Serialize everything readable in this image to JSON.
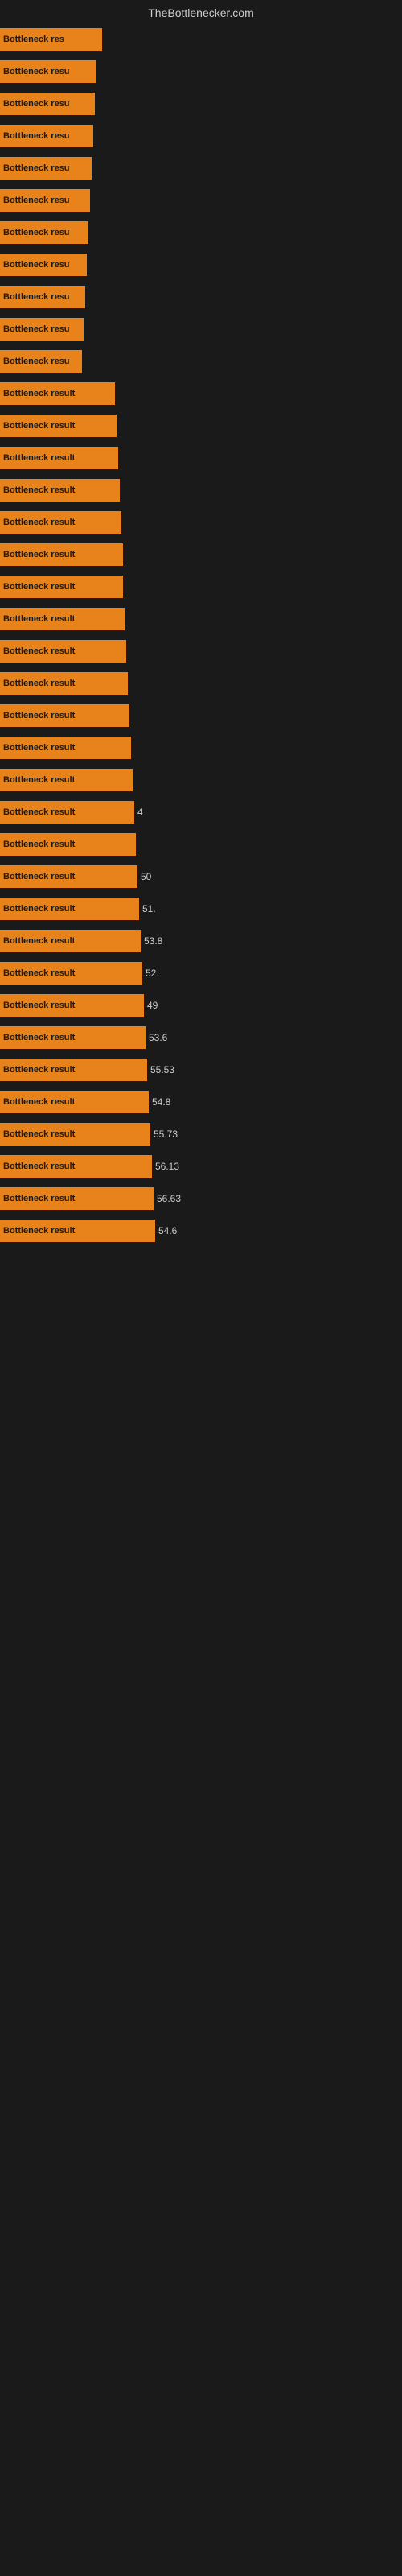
{
  "header": {
    "title": "TheBottlenecker.com"
  },
  "rows": [
    {
      "label": "Bottleneck res",
      "width": 127,
      "value": ""
    },
    {
      "label": "Bottleneck resu",
      "width": 120,
      "value": ""
    },
    {
      "label": "Bottleneck resu",
      "width": 118,
      "value": ""
    },
    {
      "label": "Bottleneck resu",
      "width": 116,
      "value": ""
    },
    {
      "label": "Bottleneck resu",
      "width": 114,
      "value": ""
    },
    {
      "label": "Bottleneck resu",
      "width": 112,
      "value": ""
    },
    {
      "label": "Bottleneck resu",
      "width": 110,
      "value": ""
    },
    {
      "label": "Bottleneck resu",
      "width": 108,
      "value": ""
    },
    {
      "label": "Bottleneck resu",
      "width": 106,
      "value": ""
    },
    {
      "label": "Bottleneck resu",
      "width": 104,
      "value": ""
    },
    {
      "label": "Bottleneck resu",
      "width": 102,
      "value": ""
    },
    {
      "label": "Bottleneck result",
      "width": 143,
      "value": ""
    },
    {
      "label": "Bottleneck result",
      "width": 145,
      "value": ""
    },
    {
      "label": "Bottleneck result",
      "width": 147,
      "value": ""
    },
    {
      "label": "Bottleneck result",
      "width": 149,
      "value": ""
    },
    {
      "label": "Bottleneck result",
      "width": 151,
      "value": ""
    },
    {
      "label": "Bottleneck result",
      "width": 153,
      "value": ""
    },
    {
      "label": "Bottleneck result",
      "width": 153,
      "value": ""
    },
    {
      "label": "Bottleneck result",
      "width": 155,
      "value": ""
    },
    {
      "label": "Bottleneck result",
      "width": 157,
      "value": ""
    },
    {
      "label": "Bottleneck result",
      "width": 159,
      "value": ""
    },
    {
      "label": "Bottleneck result",
      "width": 161,
      "value": ""
    },
    {
      "label": "Bottleneck result",
      "width": 163,
      "value": ""
    },
    {
      "label": "Bottleneck result",
      "width": 165,
      "value": ""
    },
    {
      "label": "Bottleneck result",
      "width": 167,
      "value": "4"
    },
    {
      "label": "Bottleneck result",
      "width": 169,
      "value": ""
    },
    {
      "label": "Bottleneck result",
      "width": 171,
      "value": "50"
    },
    {
      "label": "Bottleneck result",
      "width": 173,
      "value": "51."
    },
    {
      "label": "Bottleneck result",
      "width": 175,
      "value": "53.8"
    },
    {
      "label": "Bottleneck result",
      "width": 177,
      "value": "52."
    },
    {
      "label": "Bottleneck result",
      "width": 179,
      "value": "49"
    },
    {
      "label": "Bottleneck result",
      "width": 181,
      "value": "53.6"
    },
    {
      "label": "Bottleneck result",
      "width": 183,
      "value": "55.53"
    },
    {
      "label": "Bottleneck result",
      "width": 185,
      "value": "54.8"
    },
    {
      "label": "Bottleneck result",
      "width": 187,
      "value": "55.73"
    },
    {
      "label": "Bottleneck result",
      "width": 189,
      "value": "56.13"
    },
    {
      "label": "Bottleneck result",
      "width": 191,
      "value": "56.63"
    },
    {
      "label": "Bottleneck result",
      "width": 193,
      "value": "54.6"
    }
  ]
}
